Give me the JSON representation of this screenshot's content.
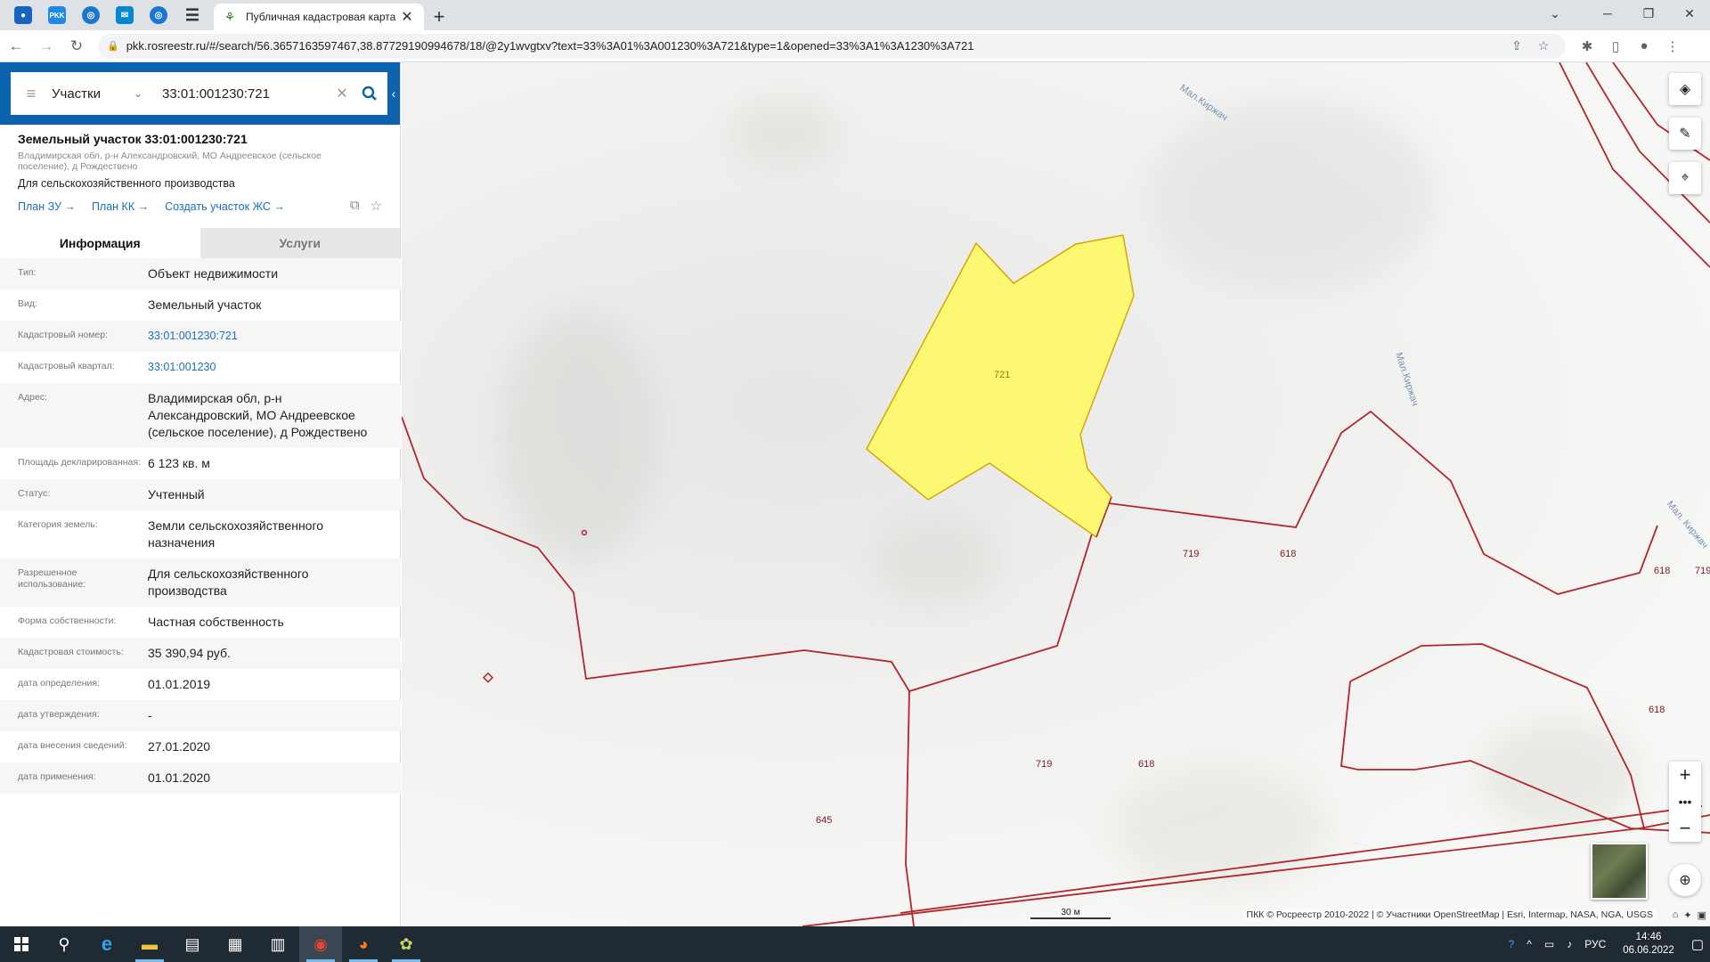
{
  "browser": {
    "tab_title": "Публичная кадастровая карта",
    "url": "pkk.rosreestr.ru/#/search/56.3657163597467,38.87729190994678/18/@2y1wvgtxv?text=33%3A01%3A001230%3A721&type=1&opened=33%3A1%3A1230%3A721",
    "pinned_tabs": [
      "drop-icon",
      "pkk-icon",
      "circle-icon",
      "mail-icon",
      "circle-icon-2",
      "list-icon"
    ]
  },
  "search": {
    "type_label": "Участки",
    "query": "33:01:001230:721"
  },
  "object": {
    "title": "Земельный участок 33:01:001230:721",
    "address_small": "Владимирская обл, р-н Александровский, МО Андреевское (сельское поселение), д Рождествено",
    "purpose": "Для сельскохозяйственного производства",
    "links": [
      "План ЗУ →",
      "План КК →",
      "Создать участок ЖС →"
    ]
  },
  "tabs": {
    "info": "Информация",
    "services": "Услуги"
  },
  "properties": [
    {
      "label": "Тип:",
      "value": "Объект недвижимости",
      "link": false
    },
    {
      "label": "Вид:",
      "value": "Земельный участок",
      "link": false
    },
    {
      "label": "Кадастровый номер:",
      "value": "33:01:001230:721",
      "link": true
    },
    {
      "label": "Кадастровый квартал:",
      "value": "33:01:001230",
      "link": true
    },
    {
      "label": "Адрес:",
      "value": "Владимирская обл, р-н Александровский, МО Андреевское (сельское поселение), д Рождествено",
      "link": false
    },
    {
      "label": "Площадь декларированная:",
      "value": "6 123 кв. м",
      "link": false
    },
    {
      "label": "Статус:",
      "value": "Учтенный",
      "link": false
    },
    {
      "label": "Категория земель:",
      "value": "Земли сельскохозяйственного назначения",
      "link": false
    },
    {
      "label": "Разрешенное использование:",
      "value": "Для сельскохозяйственного производства",
      "link": false
    },
    {
      "label": "Форма собственности:",
      "value": "Частная собственность",
      "link": false
    },
    {
      "label": "Кадастровая стоимость:",
      "value": "35 390,94 руб.",
      "link": false
    },
    {
      "label": "дата определения:",
      "value": "01.01.2019",
      "link": false
    },
    {
      "label": "дата утверждения:",
      "value": "-",
      "link": false
    },
    {
      "label": "дата внесения сведений:",
      "value": "27.01.2020",
      "link": false
    },
    {
      "label": "дата применения:",
      "value": "01.01.2020",
      "link": false
    }
  ],
  "map": {
    "parcel_labels": {
      "p721": "721",
      "p719a": "719",
      "p618a": "618",
      "p618b": "618",
      "p719b": "719",
      "p618c": "618",
      "p618d": "618",
      "p719c": "719",
      "p645": "645"
    },
    "road_labels": [
      "Мал.Киржач",
      "Мал.Киржач",
      "Мал. Киржач"
    ],
    "scale": "30 м",
    "attribution": "ПКК © Росреестр 2010-2022 | © Участники OpenStreetMap | Esri, Intermap, NASA, NGA, USGS",
    "selected_fill": "#fdf871",
    "boundary_color": "#b3262c"
  },
  "taskbar": {
    "lang": "РУС",
    "time": "14:46",
    "date": "06.06.2022"
  }
}
